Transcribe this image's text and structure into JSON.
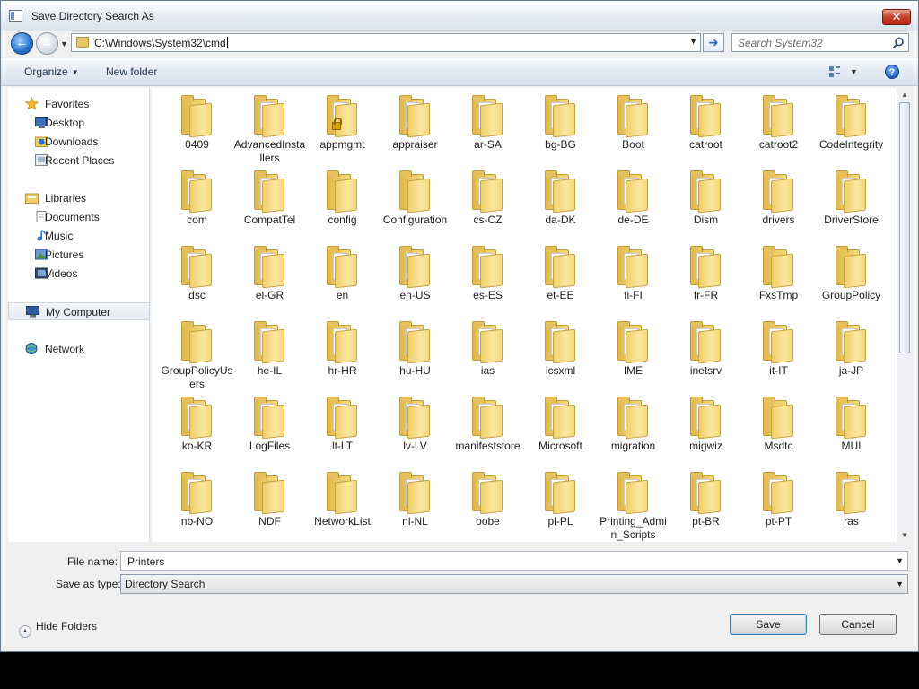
{
  "window": {
    "title": "Save Directory Search As",
    "close_label": "✕"
  },
  "address": {
    "path": "C:\\Windows\\System32\\cmd"
  },
  "search": {
    "placeholder": "Search System32"
  },
  "toolbar": {
    "organize_label": "Organize",
    "new_folder_label": "New folder",
    "help_label": "?"
  },
  "nav": {
    "favorites": "Favorites",
    "desktop": "Desktop",
    "downloads": "Downloads",
    "recent_places": "Recent Places",
    "libraries": "Libraries",
    "documents": "Documents",
    "music": "Music",
    "pictures": "Pictures",
    "videos": "Videos",
    "my_computer": "My Computer",
    "network": "Network"
  },
  "folders": [
    {
      "name": "0409",
      "empty": true
    },
    {
      "name": "AdvancedInstallers"
    },
    {
      "name": "appmgmt",
      "locked": true
    },
    {
      "name": "appraiser"
    },
    {
      "name": "ar-SA"
    },
    {
      "name": "bg-BG"
    },
    {
      "name": "Boot"
    },
    {
      "name": "catroot"
    },
    {
      "name": "catroot2"
    },
    {
      "name": "CodeIntegrity"
    },
    {
      "name": "com"
    },
    {
      "name": "CompatTel"
    },
    {
      "name": "config",
      "empty": true
    },
    {
      "name": "Configuration",
      "empty": true
    },
    {
      "name": "cs-CZ"
    },
    {
      "name": "da-DK"
    },
    {
      "name": "de-DE"
    },
    {
      "name": "Dism"
    },
    {
      "name": "drivers"
    },
    {
      "name": "DriverStore"
    },
    {
      "name": "dsc"
    },
    {
      "name": "el-GR"
    },
    {
      "name": "en"
    },
    {
      "name": "en-US"
    },
    {
      "name": "es-ES"
    },
    {
      "name": "et-EE"
    },
    {
      "name": "fi-FI"
    },
    {
      "name": "fr-FR"
    },
    {
      "name": "FxsTmp",
      "empty": true
    },
    {
      "name": "GroupPolicy",
      "empty": true
    },
    {
      "name": "GroupPolicyUsers",
      "empty": true
    },
    {
      "name": "he-IL"
    },
    {
      "name": "hr-HR"
    },
    {
      "name": "hu-HU"
    },
    {
      "name": "ias"
    },
    {
      "name": "icsxml"
    },
    {
      "name": "IME"
    },
    {
      "name": "inetsrv"
    },
    {
      "name": "it-IT"
    },
    {
      "name": "ja-JP"
    },
    {
      "name": "ko-KR"
    },
    {
      "name": "LogFiles"
    },
    {
      "name": "lt-LT"
    },
    {
      "name": "lv-LV"
    },
    {
      "name": "manifeststore"
    },
    {
      "name": "Microsoft"
    },
    {
      "name": "migration"
    },
    {
      "name": "migwiz"
    },
    {
      "name": "Msdtc",
      "empty": true
    },
    {
      "name": "MUI"
    },
    {
      "name": "nb-NO"
    },
    {
      "name": "NDF",
      "empty": true
    },
    {
      "name": "NetworkList",
      "empty": true
    },
    {
      "name": "nl-NL"
    },
    {
      "name": "oobe"
    },
    {
      "name": "pl-PL"
    },
    {
      "name": "Printing_Admin_Scripts"
    },
    {
      "name": "pt-BR"
    },
    {
      "name": "pt-PT"
    },
    {
      "name": "ras"
    }
  ],
  "footer": {
    "file_name_label": "File name:",
    "file_name_value": "Printers",
    "save_type_label": "Save as type:",
    "save_type_value": "Directory Search",
    "hide_folders_label": "Hide Folders",
    "save_label": "Save",
    "cancel_label": "Cancel"
  },
  "colors": {
    "folder": "#f0cd68",
    "accent": "#2a6fc9",
    "close": "#c8402a"
  }
}
